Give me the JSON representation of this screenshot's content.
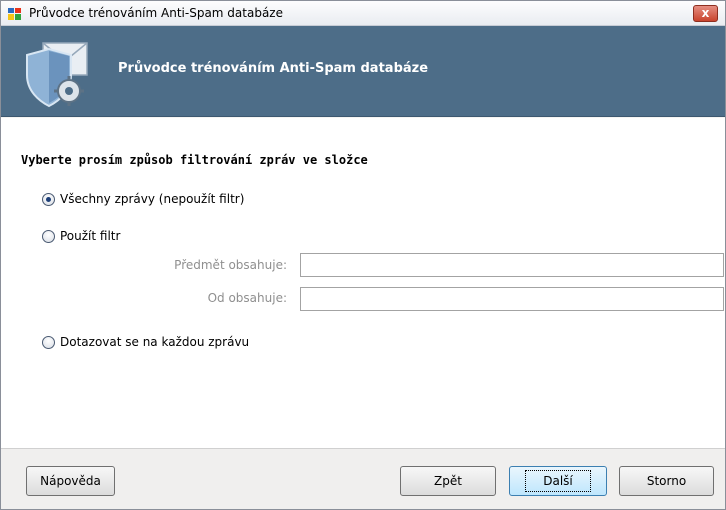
{
  "window": {
    "title": "Průvodce trénováním Anti-Spam databáze",
    "close_label": "x"
  },
  "banner": {
    "title": "Průvodce trénováním Anti-Spam databáze"
  },
  "form": {
    "question": "Vyberte prosím způsob filtrování zpráv ve složce",
    "options": [
      {
        "label": "Všechny zprávy (nepoužít filtr)",
        "checked": true
      },
      {
        "label": "Použít filtr",
        "checked": false
      },
      {
        "label": "Dotazovat se na každou zprávu",
        "checked": false
      }
    ],
    "subject_label": "Předmět obsahuje:",
    "subject_value": "",
    "from_label": "Od obsahuje:",
    "from_value": ""
  },
  "footer": {
    "help_label": "Nápověda",
    "back_label": "Zpět",
    "next_label": "Další",
    "cancel_label": "Storno"
  },
  "colors": {
    "banner": "#4d6d88",
    "close": "#c9442d"
  }
}
